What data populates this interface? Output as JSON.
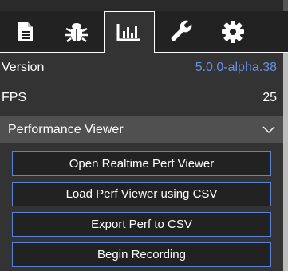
{
  "tabs": [
    {
      "icon": "file-icon",
      "active": false
    },
    {
      "icon": "bug-icon",
      "active": false
    },
    {
      "icon": "chart-icon",
      "active": true
    },
    {
      "icon": "wrench-icon",
      "active": false
    },
    {
      "icon": "gear-icon",
      "active": false
    }
  ],
  "info": {
    "version_label": "Version",
    "version_value": "5.0.0-alpha.38",
    "fps_label": "FPS",
    "fps_value": "25"
  },
  "section": {
    "title": "Performance Viewer"
  },
  "buttons": {
    "open_realtime": "Open Realtime Perf Viewer",
    "load_csv": "Load Perf Viewer using CSV",
    "export_csv": "Export Perf to CSV",
    "begin_recording": "Begin Recording"
  },
  "colors": {
    "accent": "#6c8fe6",
    "button_border": "#5a82d6",
    "background": "#333333",
    "tabbar": "#222222",
    "section_header": "#505050"
  }
}
